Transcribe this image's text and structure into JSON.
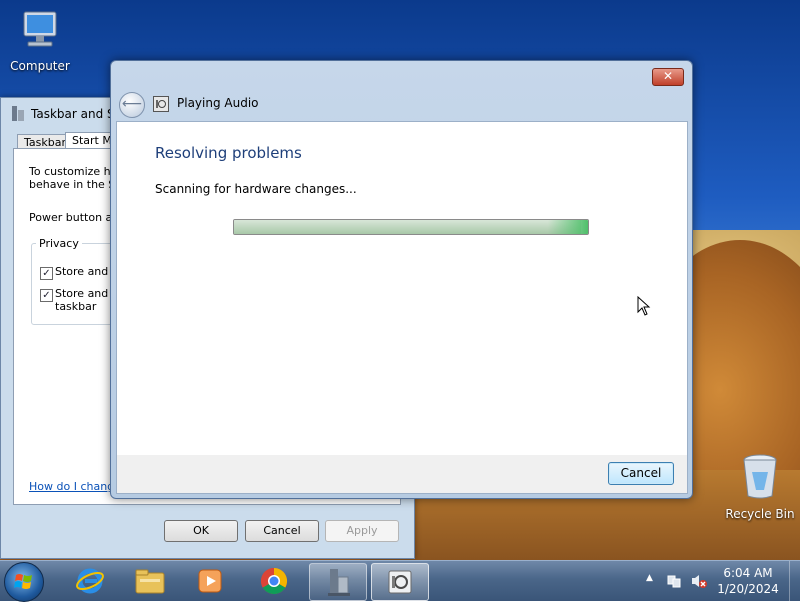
{
  "desktop": {
    "icons": [
      {
        "label": "Computer"
      },
      {
        "label": "Recycle Bin"
      }
    ]
  },
  "back_window": {
    "title": "Taskbar and St",
    "tabs": [
      "Taskbar",
      "Start Me"
    ],
    "text_line1": "To customize ho",
    "text_line2": "behave in the St",
    "power_label": "Power button ac",
    "privacy_group": "Privacy",
    "checkbox1_label": "Store and d",
    "checkbox2_label_line1": "Store and d",
    "checkbox2_label_line2": "taskbar",
    "help_link": "How do I change",
    "ok_label": "OK",
    "cancel_label": "Cancel",
    "apply_label": "Apply"
  },
  "dialog": {
    "close_glyph": "✕",
    "title": "Playing Audio",
    "heading": "Resolving problems",
    "status": "Scanning for hardware changes...",
    "progress_fraction": 0.98,
    "cancel_label": "Cancel"
  },
  "taskbar": {
    "items": [
      {
        "icon": "internet-explorer-icon"
      },
      {
        "icon": "file-explorer-icon"
      },
      {
        "icon": "media-player-icon"
      },
      {
        "icon": "chrome-icon"
      },
      {
        "icon": "taskbar-properties-icon"
      },
      {
        "icon": "troubleshooter-icon"
      }
    ],
    "tray_arrow": "▲",
    "clock_time": "6:04 AM",
    "clock_date": "1/20/2024"
  }
}
